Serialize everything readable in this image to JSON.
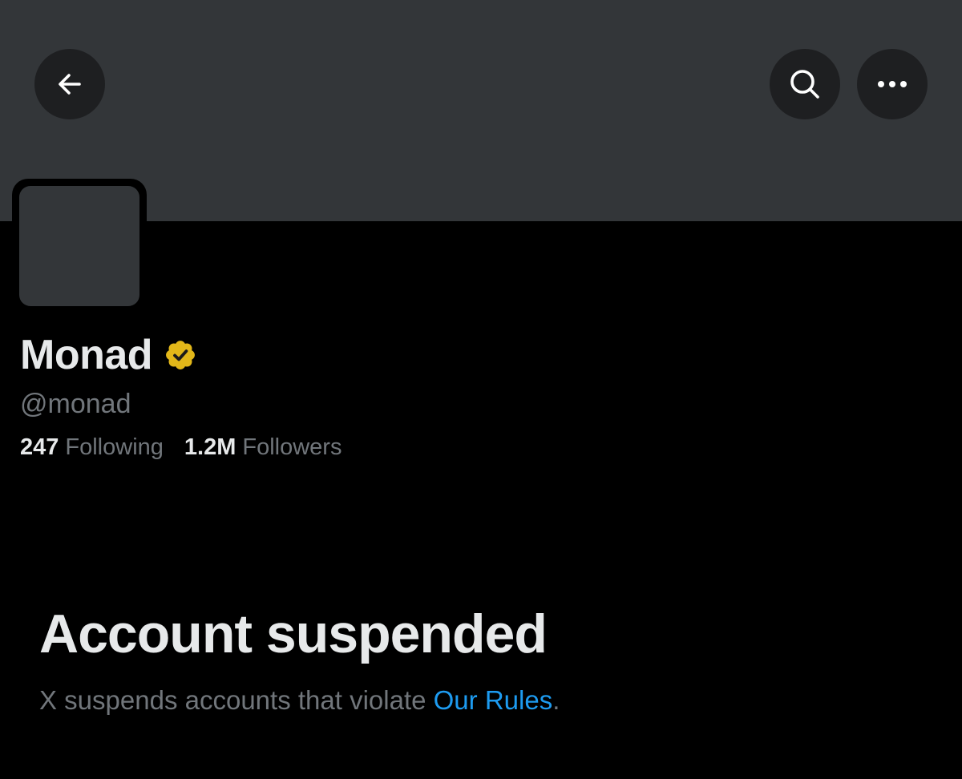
{
  "header": {
    "back_icon": "arrow-left-icon",
    "search_icon": "search-icon",
    "more_icon": "more-dots-icon"
  },
  "colors": {
    "background": "#000000",
    "banner": "#333639",
    "primary_text": "#e7e9ea",
    "secondary_text": "#71767b",
    "link": "#1d9bf0",
    "verified_badge": "#e2b719"
  },
  "profile": {
    "display_name": "Monad",
    "verified_icon": "verified-gold-badge-icon",
    "handle": "@monad",
    "following_count": "247",
    "following_label": "Following",
    "followers_count": "1.2M",
    "followers_label": "Followers"
  },
  "suspension": {
    "title": "Account suspended",
    "message": "X suspends accounts that violate",
    "link_text": "Our Rules",
    "trailing": "."
  }
}
